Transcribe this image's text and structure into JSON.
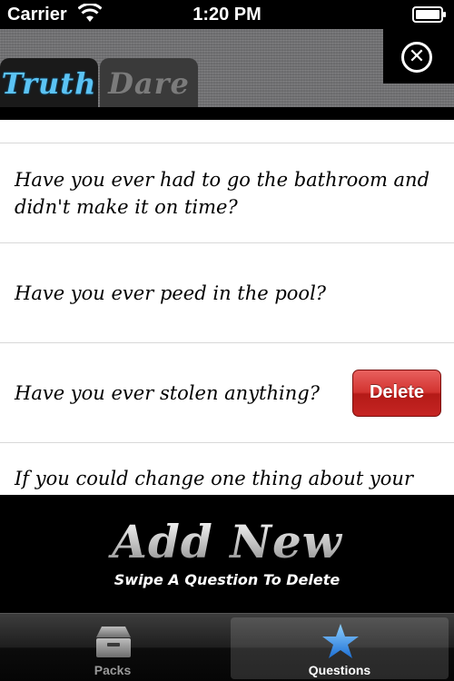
{
  "status_bar": {
    "carrier": "Carrier",
    "time": "1:20 PM",
    "wifi_icon": "wifi-icon",
    "battery_icon": "battery-icon"
  },
  "header": {
    "tabs": [
      {
        "label": "Truth",
        "selected": true
      },
      {
        "label": "Dare",
        "selected": false
      }
    ],
    "close_icon": "close-icon",
    "close_glyph": "✕"
  },
  "questions": {
    "rows": [
      {
        "text": "Have you ever had to go the bathroom and didn't make it on time?"
      },
      {
        "text": "Have you ever peed in the pool?"
      },
      {
        "text": "Have you ever stolen anything?",
        "delete_label": "Delete"
      },
      {
        "text": "If you could change one thing about your"
      }
    ]
  },
  "add_panel": {
    "title": "Add New",
    "hint": "Swipe A Question To Delete"
  },
  "tabbar": {
    "items": [
      {
        "label": "Packs",
        "icon": "box-icon",
        "selected": false
      },
      {
        "label": "Questions",
        "icon": "star-icon",
        "selected": true
      }
    ]
  },
  "colors": {
    "truth_tab": "#5bc3f4",
    "delete_button": "#d23330",
    "star_icon": "#3a8ee6"
  }
}
